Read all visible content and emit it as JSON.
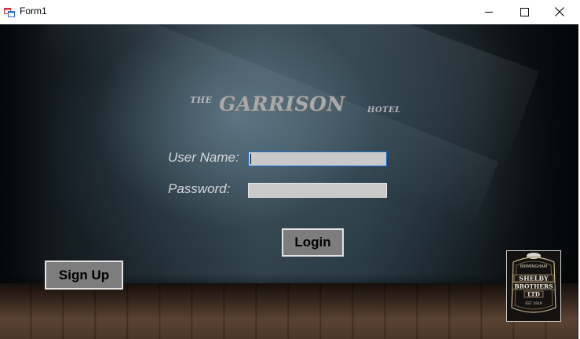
{
  "window": {
    "title": "Form1",
    "icon": "winforms-app-icon",
    "controls": {
      "minimize_icon": "minimize-icon",
      "maximize_icon": "maximize-icon",
      "close_icon": "close-icon"
    }
  },
  "logo": {
    "prefix": "THE",
    "name": "GARRISON",
    "suffix": "HOTEL"
  },
  "form": {
    "username_label": "User Name:",
    "username_value": "",
    "password_label": "Password:",
    "password_value": "",
    "login_label": "Login",
    "signup_label": "Sign Up"
  },
  "badge": {
    "top": "BIRMINGHAM",
    "line1": "SHELBY",
    "line2": "BROTHERS",
    "line3": "LTD",
    "est": "EST 1919"
  },
  "colors": {
    "input_focus_border": "#1e6fd0",
    "button_fill": "#7d7d7d",
    "input_fill": "#c9c9c9"
  }
}
